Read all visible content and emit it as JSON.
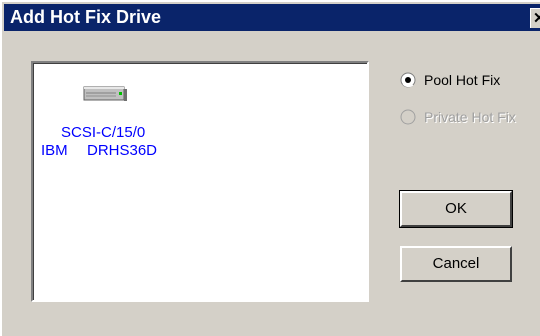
{
  "window": {
    "title": "Add Hot Fix Drive",
    "close_glyph": "✕"
  },
  "drive": {
    "icon": "hard-drive-icon",
    "name": "SCSI-C/15/0",
    "vendor": "IBM",
    "model": "DRHS36D"
  },
  "options": {
    "pool_hot_fix": {
      "label": "Pool Hot Fix",
      "selected": true,
      "enabled": true
    },
    "private_hot_fix": {
      "label": "Private Hot Fix",
      "selected": false,
      "enabled": false
    }
  },
  "buttons": {
    "ok_label": "OK",
    "cancel_label": "Cancel"
  },
  "colors": {
    "titlebar": "#0a246a",
    "face": "#d4d0c8",
    "drive_text": "#0000ff",
    "disabled_text": "#a0a0a0"
  }
}
